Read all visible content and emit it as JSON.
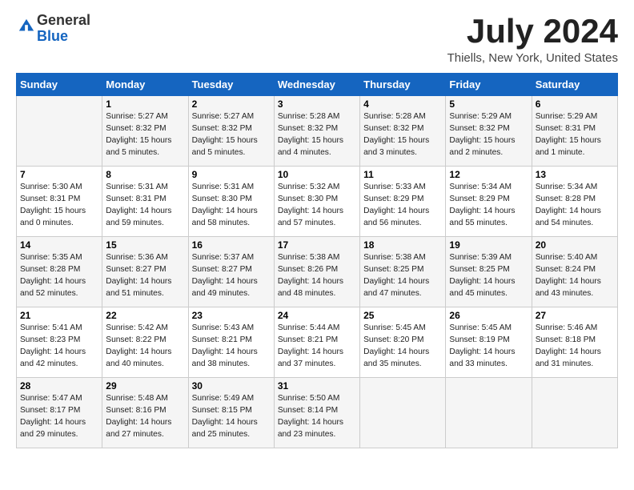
{
  "header": {
    "logo_general": "General",
    "logo_blue": "Blue",
    "month_title": "July 2024",
    "location": "Thiells, New York, United States"
  },
  "days_of_week": [
    "Sunday",
    "Monday",
    "Tuesday",
    "Wednesday",
    "Thursday",
    "Friday",
    "Saturday"
  ],
  "weeks": [
    [
      {
        "day": "",
        "info": ""
      },
      {
        "day": "1",
        "info": "Sunrise: 5:27 AM\nSunset: 8:32 PM\nDaylight: 15 hours\nand 5 minutes."
      },
      {
        "day": "2",
        "info": "Sunrise: 5:27 AM\nSunset: 8:32 PM\nDaylight: 15 hours\nand 5 minutes."
      },
      {
        "day": "3",
        "info": "Sunrise: 5:28 AM\nSunset: 8:32 PM\nDaylight: 15 hours\nand 4 minutes."
      },
      {
        "day": "4",
        "info": "Sunrise: 5:28 AM\nSunset: 8:32 PM\nDaylight: 15 hours\nand 3 minutes."
      },
      {
        "day": "5",
        "info": "Sunrise: 5:29 AM\nSunset: 8:32 PM\nDaylight: 15 hours\nand 2 minutes."
      },
      {
        "day": "6",
        "info": "Sunrise: 5:29 AM\nSunset: 8:31 PM\nDaylight: 15 hours\nand 1 minute."
      }
    ],
    [
      {
        "day": "7",
        "info": "Sunrise: 5:30 AM\nSunset: 8:31 PM\nDaylight: 15 hours\nand 0 minutes."
      },
      {
        "day": "8",
        "info": "Sunrise: 5:31 AM\nSunset: 8:31 PM\nDaylight: 14 hours\nand 59 minutes."
      },
      {
        "day": "9",
        "info": "Sunrise: 5:31 AM\nSunset: 8:30 PM\nDaylight: 14 hours\nand 58 minutes."
      },
      {
        "day": "10",
        "info": "Sunrise: 5:32 AM\nSunset: 8:30 PM\nDaylight: 14 hours\nand 57 minutes."
      },
      {
        "day": "11",
        "info": "Sunrise: 5:33 AM\nSunset: 8:29 PM\nDaylight: 14 hours\nand 56 minutes."
      },
      {
        "day": "12",
        "info": "Sunrise: 5:34 AM\nSunset: 8:29 PM\nDaylight: 14 hours\nand 55 minutes."
      },
      {
        "day": "13",
        "info": "Sunrise: 5:34 AM\nSunset: 8:28 PM\nDaylight: 14 hours\nand 54 minutes."
      }
    ],
    [
      {
        "day": "14",
        "info": "Sunrise: 5:35 AM\nSunset: 8:28 PM\nDaylight: 14 hours\nand 52 minutes."
      },
      {
        "day": "15",
        "info": "Sunrise: 5:36 AM\nSunset: 8:27 PM\nDaylight: 14 hours\nand 51 minutes."
      },
      {
        "day": "16",
        "info": "Sunrise: 5:37 AM\nSunset: 8:27 PM\nDaylight: 14 hours\nand 49 minutes."
      },
      {
        "day": "17",
        "info": "Sunrise: 5:38 AM\nSunset: 8:26 PM\nDaylight: 14 hours\nand 48 minutes."
      },
      {
        "day": "18",
        "info": "Sunrise: 5:38 AM\nSunset: 8:25 PM\nDaylight: 14 hours\nand 47 minutes."
      },
      {
        "day": "19",
        "info": "Sunrise: 5:39 AM\nSunset: 8:25 PM\nDaylight: 14 hours\nand 45 minutes."
      },
      {
        "day": "20",
        "info": "Sunrise: 5:40 AM\nSunset: 8:24 PM\nDaylight: 14 hours\nand 43 minutes."
      }
    ],
    [
      {
        "day": "21",
        "info": "Sunrise: 5:41 AM\nSunset: 8:23 PM\nDaylight: 14 hours\nand 42 minutes."
      },
      {
        "day": "22",
        "info": "Sunrise: 5:42 AM\nSunset: 8:22 PM\nDaylight: 14 hours\nand 40 minutes."
      },
      {
        "day": "23",
        "info": "Sunrise: 5:43 AM\nSunset: 8:21 PM\nDaylight: 14 hours\nand 38 minutes."
      },
      {
        "day": "24",
        "info": "Sunrise: 5:44 AM\nSunset: 8:21 PM\nDaylight: 14 hours\nand 37 minutes."
      },
      {
        "day": "25",
        "info": "Sunrise: 5:45 AM\nSunset: 8:20 PM\nDaylight: 14 hours\nand 35 minutes."
      },
      {
        "day": "26",
        "info": "Sunrise: 5:45 AM\nSunset: 8:19 PM\nDaylight: 14 hours\nand 33 minutes."
      },
      {
        "day": "27",
        "info": "Sunrise: 5:46 AM\nSunset: 8:18 PM\nDaylight: 14 hours\nand 31 minutes."
      }
    ],
    [
      {
        "day": "28",
        "info": "Sunrise: 5:47 AM\nSunset: 8:17 PM\nDaylight: 14 hours\nand 29 minutes."
      },
      {
        "day": "29",
        "info": "Sunrise: 5:48 AM\nSunset: 8:16 PM\nDaylight: 14 hours\nand 27 minutes."
      },
      {
        "day": "30",
        "info": "Sunrise: 5:49 AM\nSunset: 8:15 PM\nDaylight: 14 hours\nand 25 minutes."
      },
      {
        "day": "31",
        "info": "Sunrise: 5:50 AM\nSunset: 8:14 PM\nDaylight: 14 hours\nand 23 minutes."
      },
      {
        "day": "",
        "info": ""
      },
      {
        "day": "",
        "info": ""
      },
      {
        "day": "",
        "info": ""
      }
    ]
  ]
}
